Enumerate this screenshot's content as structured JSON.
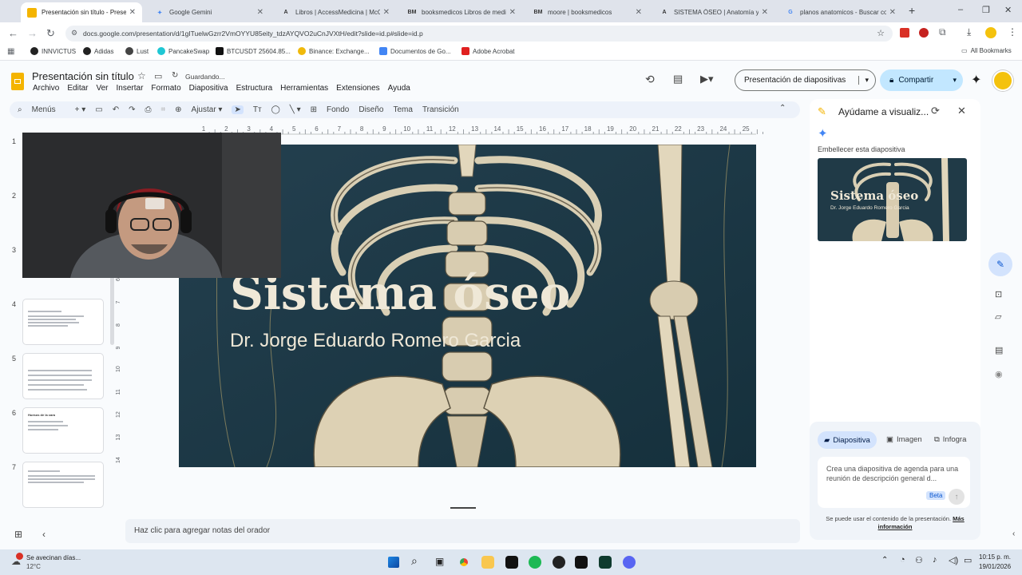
{
  "browser": {
    "tabs": [
      {
        "title": "Presentación sin título - Presentaciones de Google",
        "icon": "slides-icon",
        "color": "#f4b400",
        "active": true
      },
      {
        "title": "Google Gemini",
        "icon": "gemini-icon",
        "color": "#4285f4"
      },
      {
        "title": "Libros | AccessMedicina | McGraw Hill",
        "icon": "access-icon",
        "color": "#333333"
      },
      {
        "title": "booksmedicos Libros de medicina",
        "icon": "bm-icon",
        "color": "#333333"
      },
      {
        "title": "moore | booksmedicos",
        "icon": "bm-icon",
        "color": "#333333"
      },
      {
        "title": "SISTEMA ÓSEO | Anatomía y fisiología",
        "icon": "access-icon",
        "color": "#333333"
      },
      {
        "title": "planos anatomicos - Buscar con Google",
        "icon": "google-icon",
        "color": "#4285f4"
      }
    ],
    "new_tab": "+",
    "url": "docs.google.com/presentation/d/1gITuelwGzrr2VmOYYU85eity_tdzAYQVO2uCnJVXtH/edit?slide=id.p#slide=id.p",
    "bookmarks": [
      {
        "label": "INNVICTUS",
        "color": "#222222"
      },
      {
        "label": "Adidas",
        "color": "#222222"
      },
      {
        "label": "Lust",
        "color": "#444444"
      },
      {
        "label": "PancakeSwap",
        "color": "#1fc7d4"
      },
      {
        "label": "BTCUSDT 25604.85...",
        "color": "#111111"
      },
      {
        "label": "Binance: Exchange...",
        "color": "#f0b90b"
      },
      {
        "label": "Documentos de Go...",
        "color": "#4285f4"
      },
      {
        "label": "Adobe Acrobat",
        "color": "#e02020"
      }
    ],
    "all_bookmarks": "All Bookmarks"
  },
  "docs": {
    "title": "Presentación sin título",
    "status": "Guardando...",
    "menus": [
      "Archivo",
      "Editar",
      "Ver",
      "Insertar",
      "Formato",
      "Diapositiva",
      "Estructura",
      "Herramientas",
      "Extensiones",
      "Ayuda"
    ],
    "present_label": "Presentación de diapositivas",
    "share_label": "Compartir",
    "avatar_color": "#f4c20d",
    "toolbar": {
      "search": "Menús",
      "zoom": "Ajustar",
      "fondo": "Fondo",
      "diseno": "Diseño",
      "tema": "Tema",
      "transicion": "Transición"
    },
    "ruler_marks": [
      "1",
      "2",
      "3",
      "4",
      "5",
      "6",
      "7",
      "8",
      "9",
      "10",
      "11",
      "12",
      "13",
      "14",
      "15",
      "16",
      "17",
      "18",
      "19",
      "20",
      "21",
      "22",
      "23",
      "24",
      "25"
    ],
    "vruler_marks": [
      "6",
      "7",
      "8",
      "9",
      "10",
      "11",
      "12",
      "13",
      "14"
    ],
    "slide_numbers": [
      "1",
      "2",
      "3",
      "4",
      "5",
      "6",
      "7"
    ],
    "slide": {
      "title": "Sistema óseo",
      "subtitle": "Dr. Jorge Eduardo Romero Garcia"
    },
    "thumb6_heading": "Huesos de la cara",
    "notes_placeholder": "Haz clic para agregar notas del orador"
  },
  "gemini": {
    "title": "Ayúdame a visualiz...",
    "section": "Embellecer esta diapositiva",
    "preview_title": "Sistema óseo",
    "preview_subtitle": "Dr. Jorge Eduardo Romero Garcia",
    "tabs": [
      "Diapositiva",
      "Imagen",
      "Infogra"
    ],
    "prompt_placeholder": "Crea una diapositiva de agenda para una reunión de descripción general d...",
    "beta": "Beta",
    "footer": "Se puede usar el contenido de la presentación.",
    "footer_link": "Más información"
  },
  "taskbar": {
    "weather_title": "Se avecinan días...",
    "weather_temp": "12°C",
    "time": "10:15 p. m.",
    "date": "19/01/2026"
  }
}
